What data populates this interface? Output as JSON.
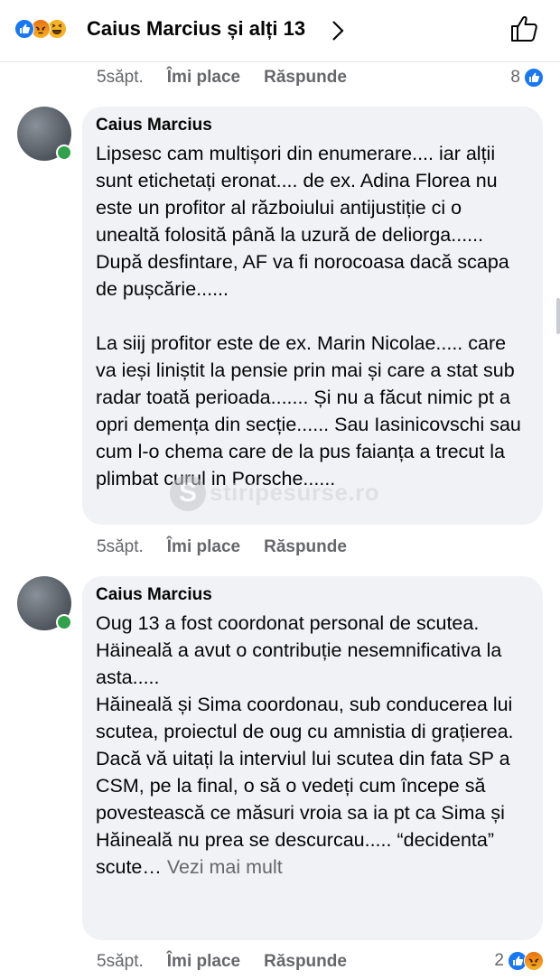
{
  "header": {
    "reactions": [
      "like",
      "angry",
      "haha"
    ],
    "title": "Caius Marcius și alți 13",
    "chevron_icon": "chevron-right",
    "like_icon": "thumbs-up-outline"
  },
  "row1": {
    "time": "5săpt.",
    "like": "Îmi place",
    "reply": "Răspunde",
    "count": "8"
  },
  "comment1": {
    "author": "Caius Marcius",
    "text": "Lipsesc cam multișori din enumerare.... iar alții sunt etichetați eronat.... de ex. Adina Florea nu este un profitor al războiului antijustiție ci o unealtă folosită până la uzură de deliorga...... După desfintare, AF va fi norocoasa dacă scapa de pușcărie......\n\nLa siij profitor este de ex. Marin Nicolae..... care va ieși liniștit la pensie prin mai și care a stat sub radar toată perioada....... Și nu a făcut nimic pt a opri demența din secție...... Sau Iasinicovschi sau cum l-o chema care de la pus faianța a trecut la plimbat curul in Porsche......",
    "time": "5săpt.",
    "like": "Îmi place",
    "reply": "Răspunde"
  },
  "watermark": {
    "letter": "S",
    "text": "stiripesurse.ro"
  },
  "comment2": {
    "author": "Caius Marcius",
    "text": "Oug 13 a fost coordonat personal de scutea. Häineală a avut o contribuție nesemnificativa la asta.....\nHăineală și Sima coordonau, sub conducerea lui scutea, proiectul de oug cu amnistia di grațierea.\nDacă vă uitați la interviul lui scutea din fata SP a CSM, pe la final, o să o vedeți cum începe să povestească ce măsuri vroia sa ia pt ca Sima și Hăineală nu prea se descurcau..... “decidenta” scute…",
    "see_more": "Vezi mai mult",
    "time": "5săpt.",
    "like": "Îmi place",
    "reply": "Răspunde",
    "count": "2",
    "reactions": [
      "like",
      "angry"
    ]
  },
  "colors": {
    "accent": "#1877f2",
    "bubble": "#f0f2f5",
    "muted_text": "#65676b",
    "online": "#31a24c"
  }
}
